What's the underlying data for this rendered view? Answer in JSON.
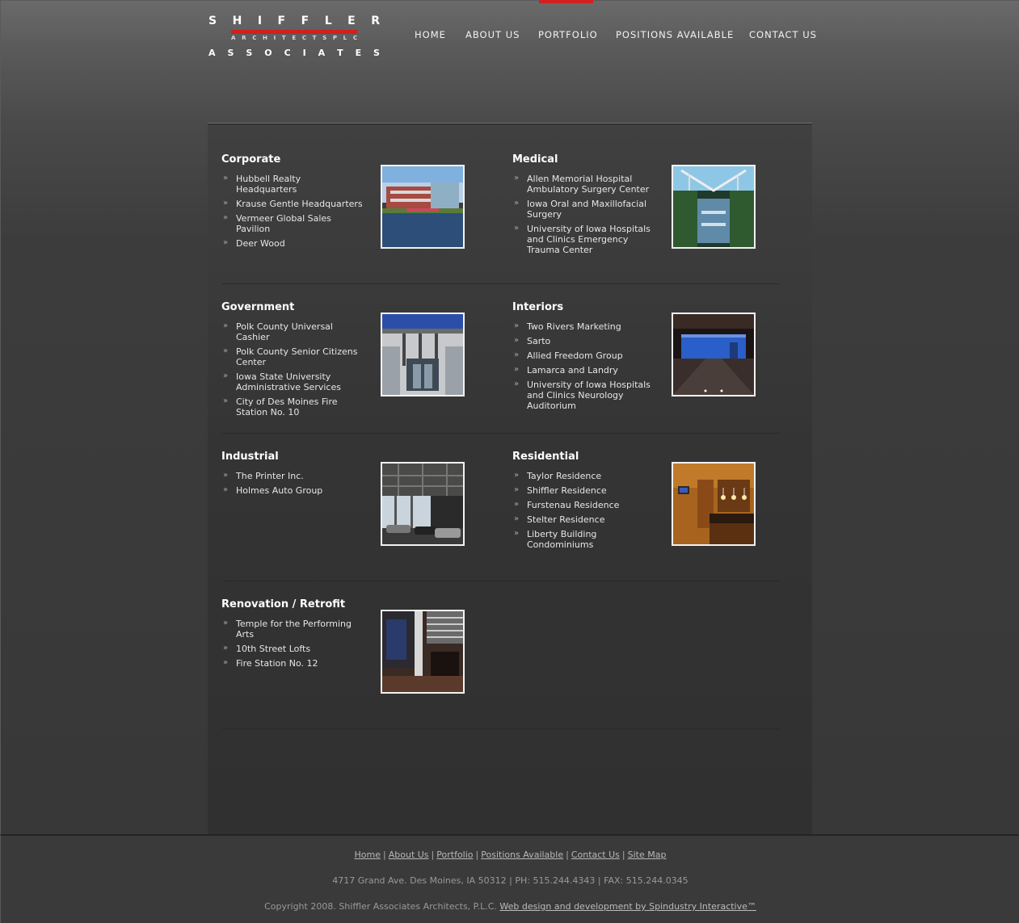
{
  "logo": {
    "line1": [
      "S",
      "H",
      "I",
      "F",
      "F",
      "L",
      "E",
      "R"
    ],
    "line2": [
      "A",
      "R",
      "C",
      "H",
      "I",
      "T",
      "E",
      "C",
      "T",
      "S",
      "P",
      "L",
      "C"
    ],
    "line3": [
      "A",
      "S",
      "S",
      "O",
      "C",
      "I",
      "A",
      "T",
      "E",
      "S"
    ]
  },
  "nav": {
    "home": "HOME",
    "about": "ABOUT US",
    "portfolio": "PORTFOLIO",
    "positions": "POSITIONS AVAILABLE",
    "contact": "CONTACT US",
    "active": "portfolio"
  },
  "colors": {
    "accent": "#d21f1f"
  },
  "bullet_icon": "»",
  "sections": {
    "corporate": {
      "title": "Corporate",
      "items": [
        "Hubbell Realty Headquarters",
        "Krause Gentle Headquarters",
        "Vermeer Global Sales Pavilion",
        "Deer Wood"
      ]
    },
    "medical": {
      "title": "Medical",
      "items": [
        "Allen Memorial Hospital Ambulatory Surgery Center",
        "Iowa Oral and Maxillofacial Surgery",
        "University of Iowa Hospitals and Clinics Emergency Trauma Center"
      ]
    },
    "government": {
      "title": "Government",
      "items": [
        "Polk County Universal Cashier",
        "Polk County Senior Citizens Center",
        "Iowa State University Administrative Services",
        "City of Des Moines Fire Station No. 10"
      ]
    },
    "interiors": {
      "title": "Interiors",
      "items": [
        "Two Rivers Marketing",
        "Sarto",
        "Allied Freedom Group",
        "Lamarca and Landry",
        "University of Iowa Hospitals and Clinics Neurology Auditorium"
      ]
    },
    "industrial": {
      "title": "Industrial",
      "items": [
        "The Printer Inc.",
        "Holmes Auto Group"
      ]
    },
    "residential": {
      "title": "Residential",
      "items": [
        "Taylor Residence",
        "Shiffler Residence",
        "Furstenau Residence",
        "Stelter Residence",
        "Liberty Building Condominiums"
      ]
    },
    "renovation": {
      "title": "Renovation / Retrofit",
      "items": [
        "Temple for the Performing Arts",
        "10th Street Lofts",
        "Fire Station No. 12"
      ]
    }
  },
  "footer": {
    "links": [
      "Home",
      "About Us",
      "Portfolio",
      "Positions Available",
      "Contact Us",
      "Site Map"
    ],
    "separator": "|",
    "address": "4717 Grand Ave. Des Moines, IA 50312 | PH: 515.244.4343 | FAX: 515.244.0345",
    "copyright": "Copyright 2008. Shiffler Associates Architects, P.L.C.",
    "credit": "Web design and development by Spindustry Interactive™"
  }
}
